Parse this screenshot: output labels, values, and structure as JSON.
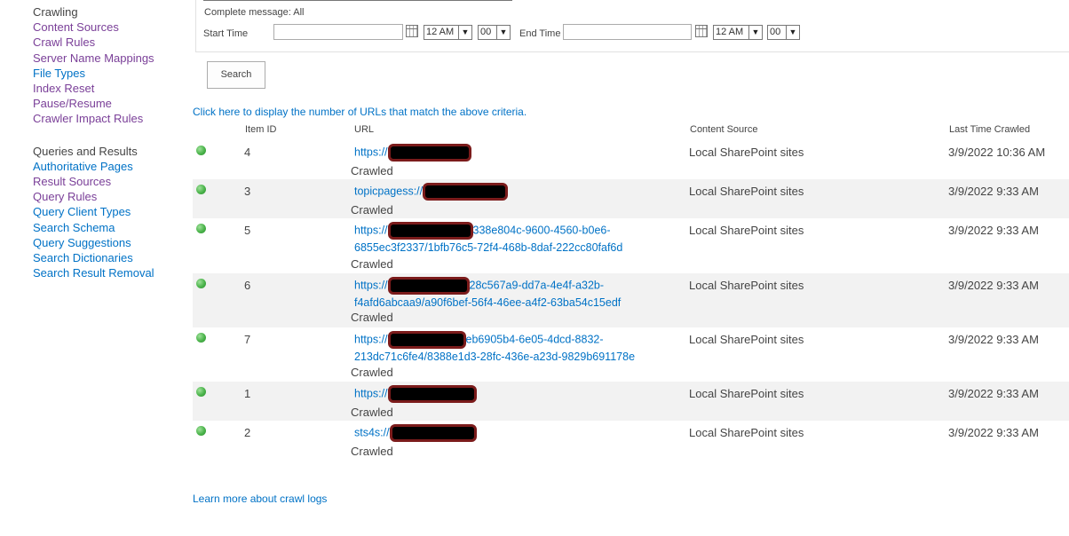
{
  "sidebar": {
    "crawling_heading": "Crawling",
    "crawling_items": [
      "Content Sources",
      "Crawl Rules",
      "Server Name Mappings",
      "File Types",
      "Index Reset",
      "Pause/Resume",
      "Crawler Impact Rules"
    ],
    "queries_heading": "Queries and Results",
    "queries_items": [
      "Authoritative Pages",
      "Result Sources",
      "Query Rules",
      "Query Client Types",
      "Search Schema",
      "Query Suggestions",
      "Search Dictionaries",
      "Search Result Removal"
    ]
  },
  "filter": {
    "complete_message": "Complete message: All",
    "start_time_label": "Start Time",
    "end_time_label": "End Time",
    "start_hour": "12 AM",
    "start_minute": "00",
    "end_hour": "12 AM",
    "end_minute": "00",
    "search_button": "Search"
  },
  "count_link": "Click here to display the number of URLs that match the above criteria.",
  "columns": {
    "item_id": "Item ID",
    "url": "URL",
    "content_source": "Content Source",
    "last_time_crawled": "Last Time Crawled"
  },
  "rows": [
    {
      "id": "4",
      "url1": "https://",
      "url1_tail": "",
      "url2": "",
      "status": "Crawled",
      "source": "Local SharePoint sites",
      "time": "3/9/2022 10:36 AM"
    },
    {
      "id": "3",
      "url1": "topicpagess://",
      "url1_tail": "",
      "url2": "",
      "status": "Crawled",
      "source": "Local SharePoint sites",
      "time": "3/9/2022 9:33 AM"
    },
    {
      "id": "5",
      "url1": "https://",
      "url1_tail": "338e804c-9600-4560-b0e6-",
      "url2": "6855ec3f2337/1bfb76c5-72f4-468b-8daf-222cc80faf6d",
      "status": "Crawled",
      "source": "Local SharePoint sites",
      "time": "3/9/2022 9:33 AM"
    },
    {
      "id": "6",
      "url1": "https://",
      "url1_tail": "28c567a9-dd7a-4e4f-a32b-",
      "url2": "f4afd6abcaa9/a90f6bef-56f4-46ee-a4f2-63ba54c15edf",
      "status": "Crawled",
      "source": "Local SharePoint sites",
      "time": "3/9/2022 9:33 AM"
    },
    {
      "id": "7",
      "url1": "https://",
      "url1_tail": "eb6905b4-6e05-4dcd-8832-",
      "url2": "213dc71c6fe4/8388e1d3-28fc-436e-a23d-9829b691178e",
      "status": "Crawled",
      "source": "Local SharePoint sites",
      "time": "3/9/2022 9:33 AM"
    },
    {
      "id": "1",
      "url1": "https://",
      "url1_tail": "",
      "url2": "",
      "status": "Crawled",
      "source": "Local SharePoint sites",
      "time": "3/9/2022 9:33 AM"
    },
    {
      "id": "2",
      "url1": "sts4s://",
      "url1_tail": "",
      "url2": "",
      "status": "Crawled",
      "source": "Local SharePoint sites",
      "time": "3/9/2022 9:33 AM"
    }
  ],
  "learn_more": "Learn more about crawl logs",
  "colors": {
    "link": "#0072c6",
    "visited_link": "#7a3f98",
    "alt_row": "#f2f2f2",
    "success_dot": "#4ab34a"
  }
}
